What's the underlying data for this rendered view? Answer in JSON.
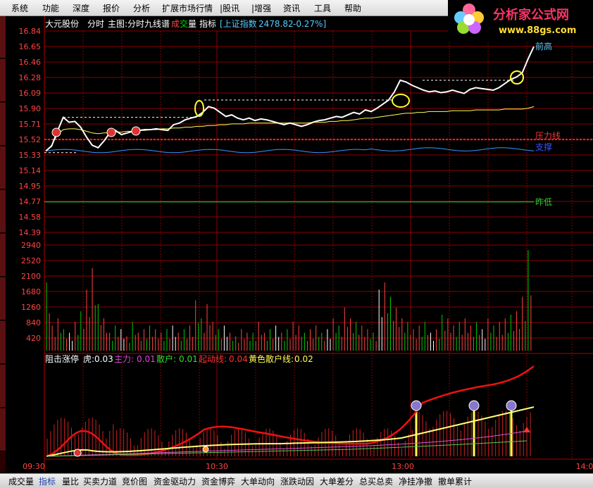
{
  "menu": [
    "系统",
    "功能",
    "深度",
    "报价",
    "分析",
    "扩展市场行情",
    "|股讯",
    "|增强",
    "资讯",
    "工具",
    "帮助"
  ],
  "logo": {
    "title": "分析家公式网",
    "url": "www.88gs.com"
  },
  "header": {
    "stock_name": "大元股份",
    "mode": "分时",
    "main_chart": "主图:分时九线谱",
    "vol_a": "成",
    "vol_b": "交",
    "vol_c": "量",
    "indicator": "指标",
    "index_label": "[上证指数",
    "index_value": "2478.82",
    "index_change": "-0.27%]"
  },
  "price_axis": [
    "16.84",
    "16.65",
    "16.46",
    "16.28",
    "16.09",
    "15.90",
    "15.71",
    "15.52",
    "15.33",
    "15.14",
    "14.95",
    "14.77",
    "14.58",
    "14.39"
  ],
  "volume_axis": [
    "2940",
    "2520",
    "2100",
    "1680",
    "1260",
    "840",
    "420"
  ],
  "time_axis": [
    "09:30",
    "10:30",
    "13:00",
    "14:0"
  ],
  "annotations": {
    "prev_high": "前高",
    "resistance": "压力线",
    "support": "支撑",
    "prev_low": "昨低"
  },
  "indicator_panel": {
    "name": "阻击涨停",
    "tiger_label": "虎:",
    "tiger_value": "0.03",
    "main_label": "主力:",
    "main_value": "0.01",
    "retail_label": "散户:",
    "retail_value": "0.01",
    "launch_label": "起动线:",
    "launch_value": "0.04",
    "yellow_label": "黄色散户线:",
    "yellow_value": "0.02"
  },
  "bottom_tabs": [
    "成交量",
    "指标",
    "量比",
    "买卖力道",
    "竞价图",
    "资金驱动力",
    "资金博弈",
    "大单动向",
    "涨跌动因",
    "大单差分",
    "总买总卖",
    "净挂净撤",
    "撤单累计"
  ],
  "active_tab": "指标",
  "colors": {
    "grid": "#8b0000",
    "price": "#ffffff",
    "avg": "#ffff55",
    "up": "#ff3333",
    "down": "#00cc00",
    "accent_yellow": "#ffff33",
    "cyan": "#55ccff"
  },
  "chart_data": {
    "type": "line",
    "price_range": [
      14.39,
      16.84
    ],
    "price": [
      15.38,
      15.44,
      15.62,
      15.79,
      15.73,
      15.74,
      15.67,
      15.55,
      15.45,
      15.42,
      15.5,
      15.6,
      15.63,
      15.58,
      15.6,
      15.62,
      15.63,
      15.64,
      15.64,
      15.65,
      15.64,
      15.63,
      15.7,
      15.72,
      15.76,
      15.78,
      15.8,
      15.85,
      15.92,
      15.9,
      15.85,
      15.8,
      15.82,
      15.78,
      15.76,
      15.78,
      15.75,
      15.77,
      15.76,
      15.74,
      15.72,
      15.7,
      15.72,
      15.7,
      15.68,
      15.7,
      15.73,
      15.75,
      15.76,
      15.78,
      15.8,
      15.79,
      15.82,
      15.85,
      15.83,
      15.88,
      15.86,
      15.9,
      15.95,
      16.0,
      16.1,
      16.24,
      16.22,
      16.18,
      16.15,
      16.12,
      16.1,
      16.11,
      16.09,
      16.1,
      16.12,
      16.1,
      16.08,
      16.13,
      16.15,
      16.14,
      16.13,
      16.12,
      16.15,
      16.2,
      16.25,
      16.28,
      16.33,
      16.5,
      16.65
    ],
    "avg": [
      15.38,
      15.45,
      15.58,
      15.64,
      15.65,
      15.65,
      15.64,
      15.62,
      15.6,
      15.59,
      15.6,
      15.6,
      15.61,
      15.61,
      15.62,
      15.62,
      15.63,
      15.63,
      15.64,
      15.64,
      15.65,
      15.65,
      15.66,
      15.66,
      15.67,
      15.67,
      15.68,
      15.68,
      15.69,
      15.69,
      15.7,
      15.7,
      15.71,
      15.71,
      15.71,
      15.72,
      15.72,
      15.72,
      15.72,
      15.72,
      15.72,
      15.72,
      15.72,
      15.72,
      15.72,
      15.72,
      15.73,
      15.73,
      15.73,
      15.74,
      15.74,
      15.75,
      15.75,
      15.76,
      15.77,
      15.78,
      15.78,
      15.79,
      15.8,
      15.81,
      15.82,
      15.83,
      15.84,
      15.84,
      15.85,
      15.85,
      15.86,
      15.86,
      15.86,
      15.86,
      15.87,
      15.87,
      15.87,
      15.87,
      15.88,
      15.88,
      15.88,
      15.88,
      15.88,
      15.89,
      15.89,
      15.89,
      15.89,
      15.9,
      15.92
    ],
    "volume": [
      1900,
      700,
      900,
      600,
      500,
      800,
      1100,
      1700,
      2300,
      1300,
      900,
      500,
      700,
      600,
      400,
      800,
      500,
      600,
      700,
      600,
      500,
      600,
      700,
      500,
      600,
      700,
      1400,
      900,
      1300,
      800,
      600,
      700,
      500,
      400,
      600,
      500,
      500,
      800,
      500,
      600,
      700,
      500,
      600,
      800,
      700,
      500,
      600,
      700,
      500,
      600,
      900,
      700,
      1200,
      900,
      800,
      700,
      600,
      500,
      1700,
      1900,
      1500,
      1200,
      900,
      800,
      600,
      700,
      800,
      500,
      600,
      1000,
      900,
      700,
      800,
      900,
      700,
      800,
      600,
      900,
      700,
      800,
      900,
      1000,
      1100,
      1500,
      2800
    ],
    "vol_range": [
      0,
      2940
    ]
  }
}
